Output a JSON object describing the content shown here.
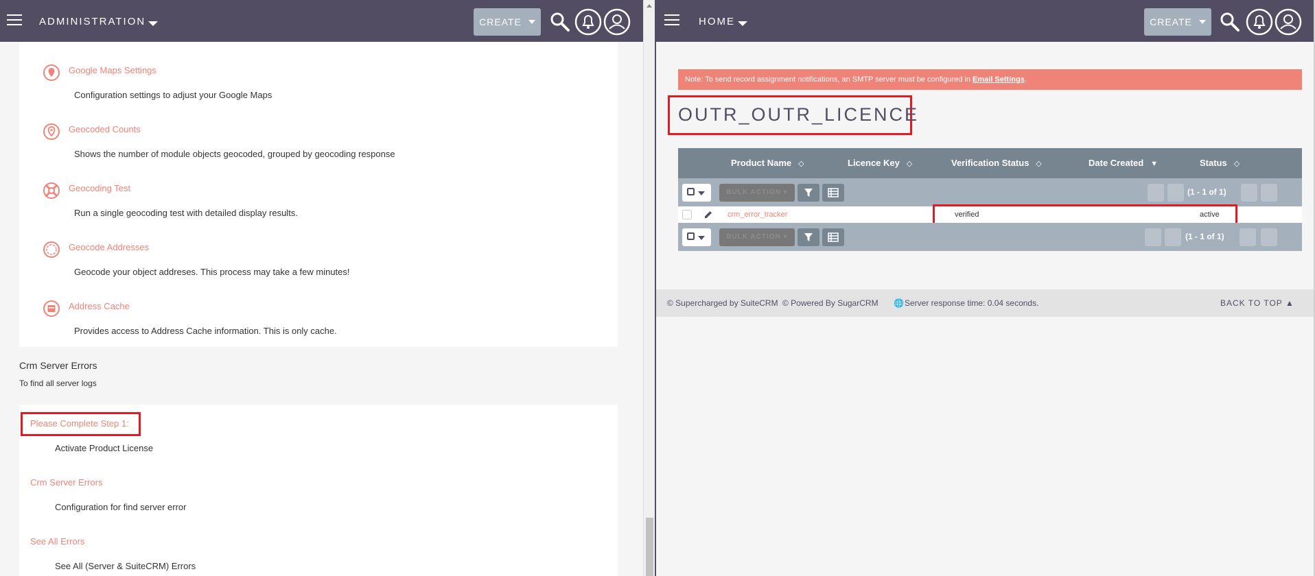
{
  "left": {
    "header": {
      "module": "ADMINISTRATION",
      "create_label": "CREATE"
    },
    "geocoding_items": [
      {
        "label": "Google Maps Settings",
        "description": "Configuration settings to adjust your Google Maps",
        "icon": "map-pin-icon"
      },
      {
        "label": "Geocoded Counts",
        "description": "Shows the number of module objects geocoded, grouped by geocoding response",
        "icon": "location-pin-icon"
      },
      {
        "label": "Geocoding Test",
        "description": "Run a single geocoding test with detailed display results.",
        "icon": "test-icon"
      },
      {
        "label": "Geocode Addresses",
        "description": "Geocode your object addreses. This process may take a few minutes!",
        "icon": "target-icon"
      },
      {
        "label": "Address Cache",
        "description": "Provides access to Address Cache information. This is only cache.",
        "icon": "cache-icon"
      }
    ],
    "crm_section": {
      "title": "Crm Server Errors",
      "subtitle": "To find all server logs",
      "items": [
        {
          "label": "Please Complete Step 1:",
          "description": "Activate Product License"
        },
        {
          "label": "Crm Server Errors",
          "description": "Configuration for find server error"
        },
        {
          "label": "See All Errors",
          "description": "See All (Server & SuiteCRM) Errors"
        }
      ]
    }
  },
  "right": {
    "header": {
      "module": "HOME",
      "create_label": "CREATE"
    },
    "notice": {
      "text": "Note: To send record assignment notifications, an SMTP server must be configured in ",
      "link": "Email Settings",
      "suffix": "."
    },
    "record_title": "OUTR_OUTR_LICENCE",
    "columns": [
      "Product Name",
      "Licence Key",
      "Verification Status",
      "Date Created",
      "Status"
    ],
    "bulk_action_label": "BULK ACTION",
    "pagination": "(1 - 1 of 1)",
    "rows": [
      {
        "product_name": "crm_error_tracker",
        "licence_key": "",
        "verification_status": "verified",
        "date_created": "",
        "status": "active"
      }
    ],
    "footer": {
      "supercharged": "© Supercharged by SuiteCRM",
      "powered": "© Powered By SugarCRM",
      "response_time": "Server response time: 0.04 seconds.",
      "back_to_top": "BACK TO TOP"
    }
  },
  "colors": {
    "header_bg": "#534d64",
    "accent": "#f08377",
    "highlight_box": "#e01b24"
  }
}
